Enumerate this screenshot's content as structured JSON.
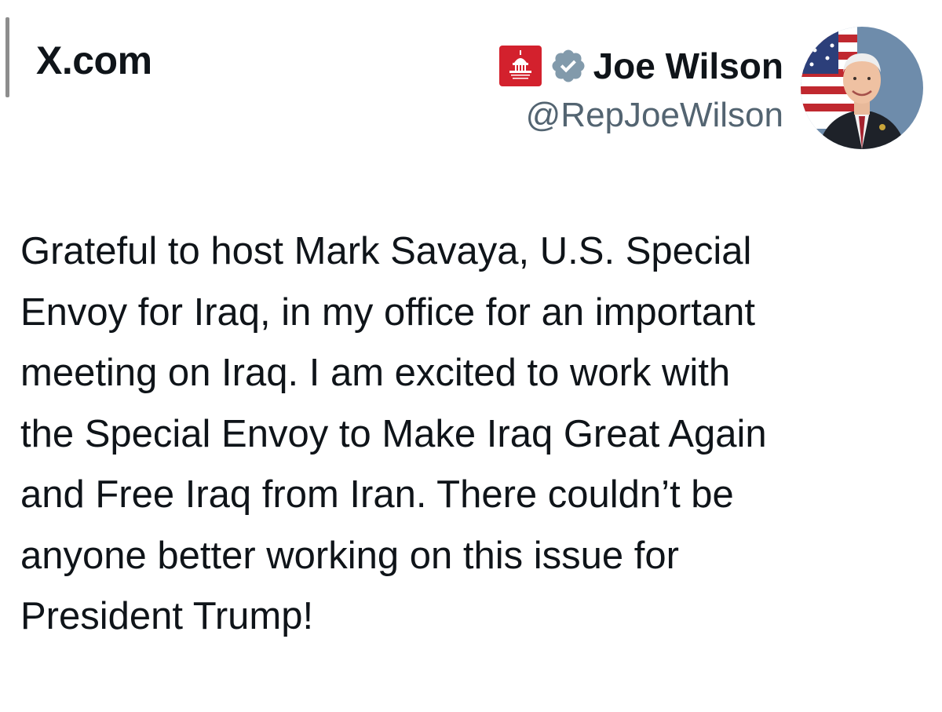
{
  "source": {
    "site": "X.com"
  },
  "author": {
    "name": "Joe Wilson",
    "handle": "@RepJoeWilson",
    "badge_text": "HOUSE GOP",
    "badge_color": "#d3212d",
    "verified_icon": "verified-badge-icon",
    "verified_color": "#829aab"
  },
  "tweet": {
    "text": "Grateful to host Mark Savaya, U.S. Special\nEnvoy for Iraq, in my office for an important\nmeeting on Iraq. I am excited to work with\nthe Special Envoy to Make Iraq Great Again\nand Free Iraq from Iran. There couldn’t be\nanyone better working on this issue for\nPresident Trump!"
  }
}
